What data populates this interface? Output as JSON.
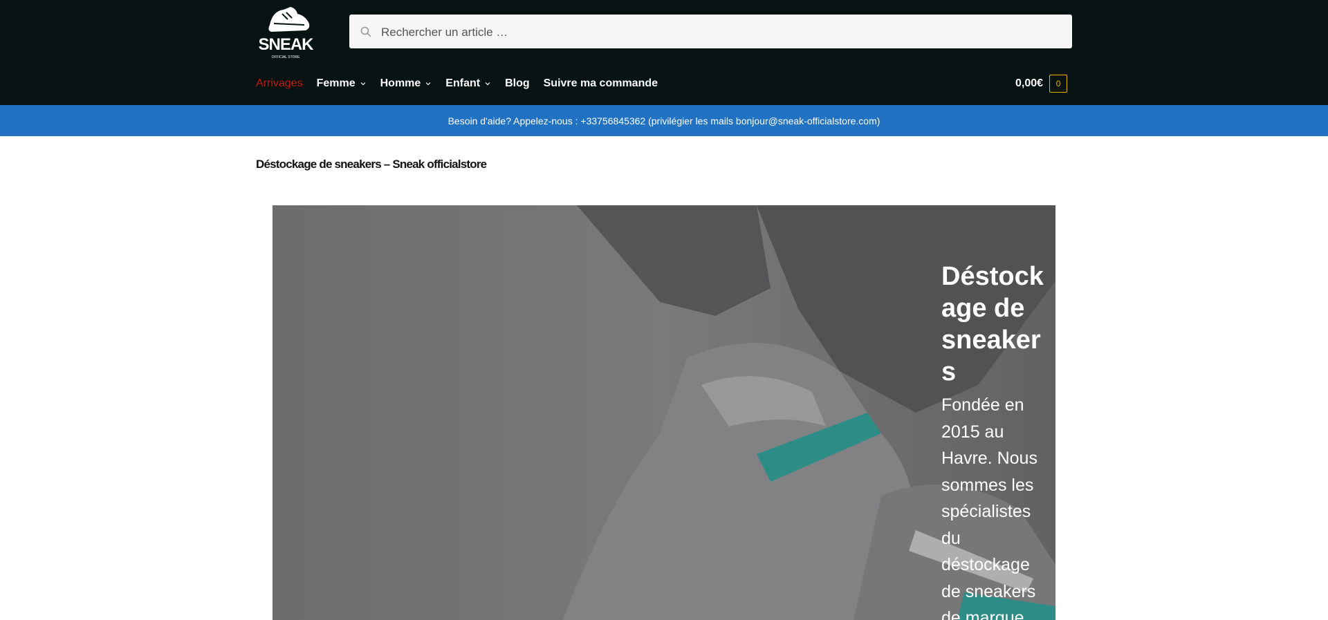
{
  "header": {
    "logo_text": "SNEAK",
    "logo_subtext": "OFFICIAL STORE"
  },
  "search": {
    "placeholder": "Rechercher un article …"
  },
  "nav": {
    "items": [
      {
        "label": "Arrivages",
        "active": true,
        "dropdown": false
      },
      {
        "label": "Femme",
        "dropdown": true
      },
      {
        "label": "Homme",
        "dropdown": true
      },
      {
        "label": "Enfant",
        "dropdown": true
      },
      {
        "label": "Blog",
        "dropdown": false
      },
      {
        "label": "Suivre ma commande",
        "dropdown": false
      }
    ]
  },
  "cart": {
    "total": "0,00€",
    "count": "0"
  },
  "banner": {
    "text": "Besoin d'aide? Appelez-nous : +33756845362  (privilégier les mails bonjour@sneak-officialstore.com)"
  },
  "page": {
    "title": "Déstockage de sneakers – Sneak officialstore"
  },
  "hero": {
    "title": "Déstockage de sneakers",
    "body": "Fondée en 2015 au Havre. Nous sommes les spécialistes du déstockage de sneakers de marque"
  },
  "colors": {
    "header_bg": "#071213",
    "banner_bg": "#2272c4",
    "active_nav": "#c2190c",
    "cart_accent": "#e8b400"
  }
}
